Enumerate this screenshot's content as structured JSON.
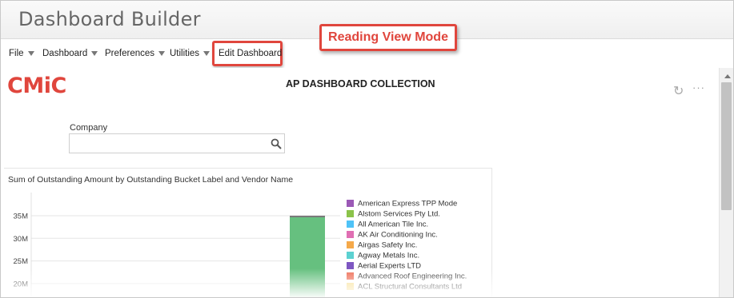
{
  "app": {
    "title": "Dashboard Builder"
  },
  "menu": {
    "items": [
      {
        "label": "File"
      },
      {
        "label": "Dashboard"
      },
      {
        "label": "Preferences"
      },
      {
        "label": "Utilities"
      }
    ],
    "edit_dashboard": "Edit Dashboard"
  },
  "callout": {
    "text": "Reading View Mode"
  },
  "brand": {
    "logo_text": "CMiC",
    "logo_color": "#e0463d"
  },
  "dashboard": {
    "title": "AP DASHBOARD COLLECTION",
    "refresh_icon": "refresh-icon",
    "more_icon": "more-icon"
  },
  "filter": {
    "company_label": "Company",
    "company_value": "",
    "company_placeholder": ""
  },
  "chart_data": {
    "type": "bar",
    "title": "Sum of Outstanding Amount by Outstanding Bucket Label and Vendor Name",
    "yticks": [
      "35M",
      "30M",
      "25M",
      "20M"
    ],
    "ylim": [
      15,
      37
    ],
    "series_color": "#66c07f",
    "cap_color": "#7a7a7a",
    "bar_value": 35,
    "legend": [
      {
        "name": "American Express TPP Mode",
        "color": "#9b59b6"
      },
      {
        "name": "Alstom Services Pty Ltd.",
        "color": "#8bc34a"
      },
      {
        "name": "All American Tile Inc.",
        "color": "#4fc3f7"
      },
      {
        "name": "AK Air Conditioning Inc.",
        "color": "#e06fb3"
      },
      {
        "name": "Airgas Safety Inc.",
        "color": "#f5a94a"
      },
      {
        "name": "Agway Metals Inc.",
        "color": "#5cd1d1"
      },
      {
        "name": "Aerial Experts LTD",
        "color": "#7e57c2"
      },
      {
        "name": "Advanced Roof Engineering Inc.",
        "color": "#ee6f57"
      },
      {
        "name": "ACL Structural Consultants Ltd",
        "color": "#f7dc8a"
      }
    ]
  }
}
